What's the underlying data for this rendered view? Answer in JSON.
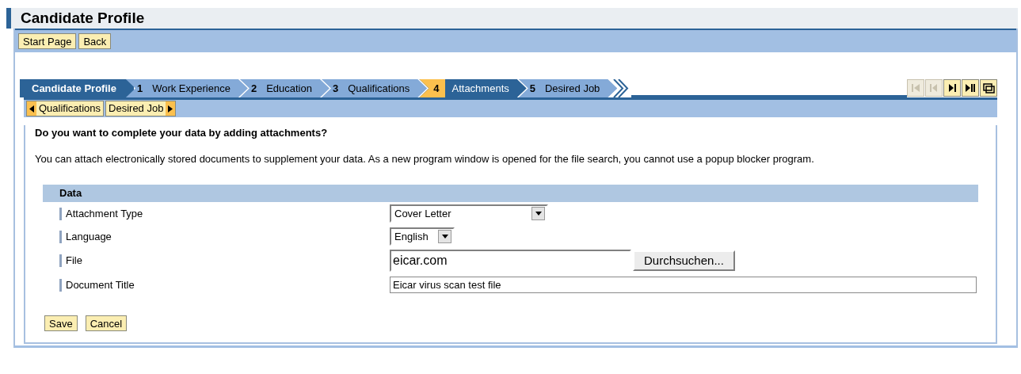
{
  "page_title": "Candidate Profile",
  "toolbar": [
    {
      "label": "Start Page"
    },
    {
      "label": "Back"
    }
  ],
  "roadmap": [
    {
      "kind": "title",
      "label": "Candidate Profile"
    },
    {
      "kind": "step",
      "number": "1",
      "label": "Work Experience",
      "selected": false
    },
    {
      "kind": "step",
      "number": "2",
      "label": "Education",
      "selected": false
    },
    {
      "kind": "step",
      "number": "3",
      "label": "Qualifications",
      "selected": false
    },
    {
      "kind": "step",
      "number": "4",
      "label": "Attachments",
      "selected": true
    },
    {
      "kind": "step",
      "number": "5",
      "label": "Desired Job",
      "selected": false
    }
  ],
  "nav_buttons": [
    {
      "kind": "first",
      "disabled": true
    },
    {
      "kind": "prev",
      "disabled": true
    },
    {
      "kind": "next",
      "disabled": false
    },
    {
      "kind": "last",
      "disabled": false
    },
    {
      "kind": "window",
      "disabled": false
    }
  ],
  "step_nav": [
    {
      "kind": "prev",
      "label": "Qualifications"
    },
    {
      "kind": "next",
      "label": "Desired Job"
    }
  ],
  "question": "Do you want to complete your data by adding attachments?",
  "info": "You can attach electronically stored documents to supplement your data. As a new program window is opened for the file search, you cannot use a popup blocker program.",
  "section_title": "Data",
  "fields": [
    {
      "kind": "select",
      "label": "Attachment Type",
      "value": "Cover Letter"
    },
    {
      "kind": "select_small",
      "label": "Language",
      "value": "English"
    },
    {
      "kind": "file",
      "label": "File",
      "value": "eicar.com",
      "button": "Durchsuchen..."
    },
    {
      "kind": "text",
      "label": "Document Title",
      "value": "Eicar virus scan test file"
    }
  ],
  "actions": [
    {
      "label": "Save"
    },
    {
      "label": "Cancel"
    }
  ]
}
